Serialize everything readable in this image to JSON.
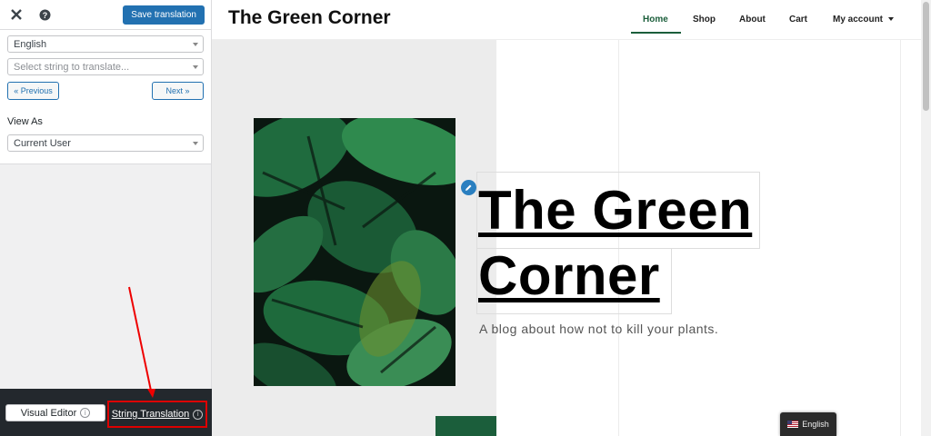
{
  "panel": {
    "save_label": "Save translation",
    "language_value": "English",
    "string_placeholder": "Select string to translate...",
    "prev_label": "« Previous",
    "next_label": "Next »",
    "view_as_label": "View As",
    "view_as_value": "Current User",
    "visual_editor_label": "Visual Editor",
    "string_translation_label": "String Translation"
  },
  "site": {
    "title": "The Green Corner",
    "menu": [
      "Home",
      "Shop",
      "About",
      "Cart",
      "My account"
    ],
    "hero_line1": "The Green",
    "hero_line2": "Corner",
    "tagline": "A blog about how not to kill your plants.",
    "language_switcher": "English"
  },
  "colors": {
    "accent": "#2271b1",
    "brand_green": "#1b5e3b",
    "highlight_red": "#dd0000"
  }
}
